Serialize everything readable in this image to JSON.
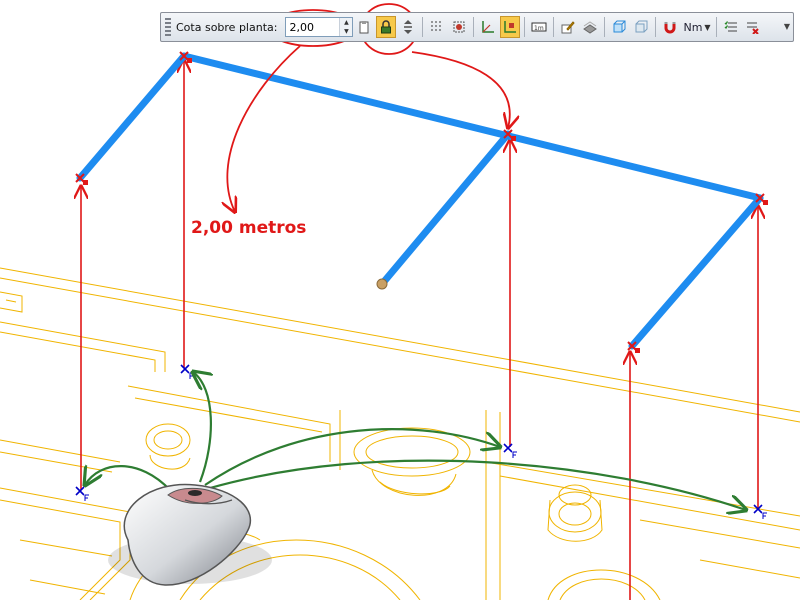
{
  "toolbar": {
    "label": "Cota sobre planta:",
    "elevation_value": "2,00",
    "units_label": "Nm",
    "active_tool": "lock-icon"
  },
  "annotation": {
    "text": "2,00 metros"
  },
  "colors": {
    "beam": "#1e8cf0",
    "guide_arrow": "#e01818",
    "mouse_path": "#2e7d32",
    "floor_plan": "#f0b400",
    "snap_marker": "#0000c8",
    "toolbar_active": "#f7c94a"
  },
  "icons": [
    "lock-icon",
    "snap-icon",
    "grid-icon",
    "orthogonal-icon",
    "snap-endpoint-icon",
    "measure-icon",
    "edit-icon",
    "layers-icon",
    "view-3d-icon",
    "view-front-icon",
    "magnet-icon",
    "checklist-icon",
    "delete-list-icon",
    "mouse-icon"
  ]
}
